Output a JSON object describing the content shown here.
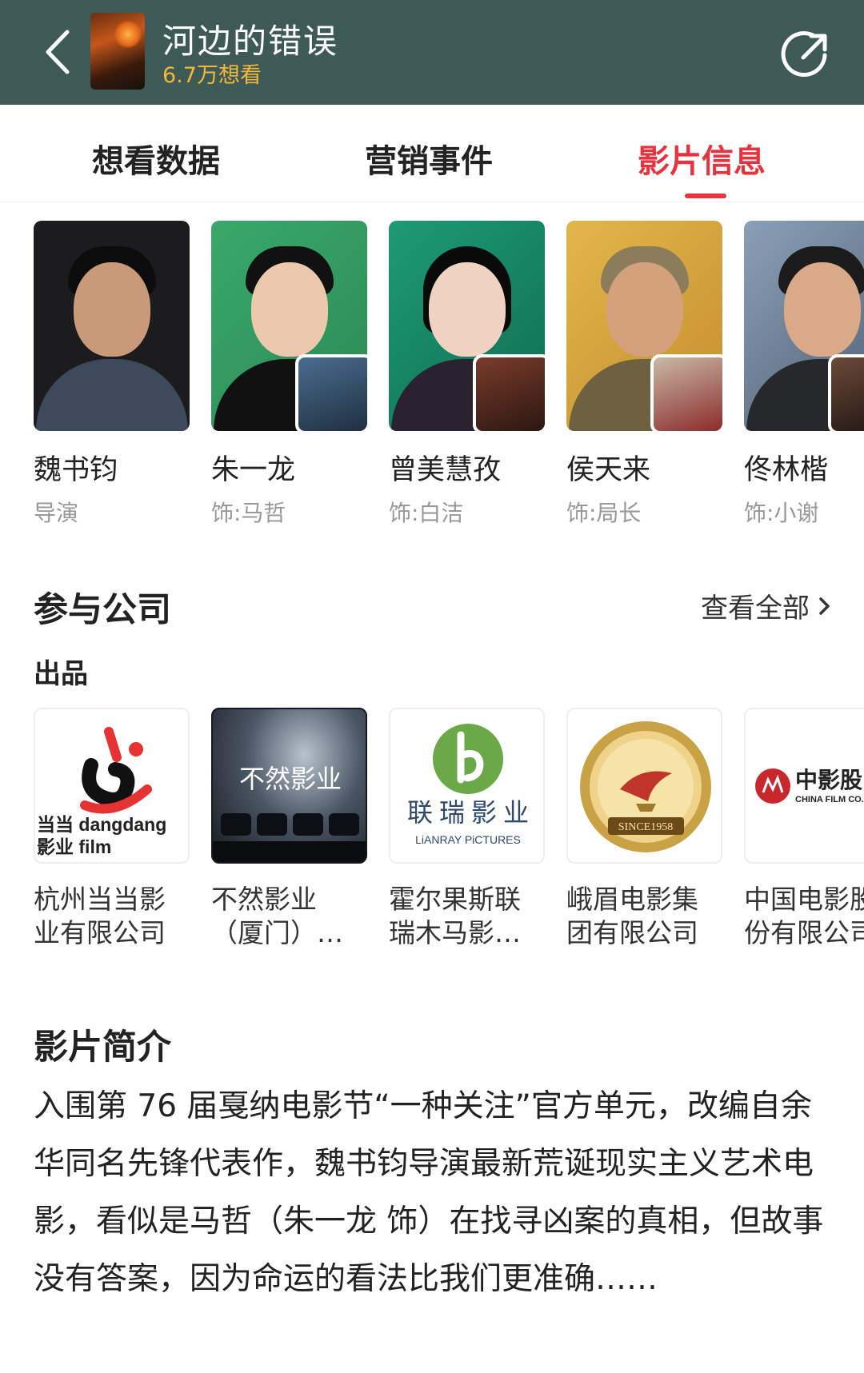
{
  "header": {
    "title": "河边的错误",
    "want_count": "6.7万想看",
    "back_icon": "chevron-left-icon",
    "share_icon": "share-icon"
  },
  "tabs": [
    {
      "label": "想看数据",
      "active": false
    },
    {
      "label": "营销事件",
      "active": false
    },
    {
      "label": "影片信息",
      "active": true
    }
  ],
  "cast": [
    {
      "name": "魏书钧",
      "role": "导演"
    },
    {
      "name": "朱一龙",
      "role": "饰:马哲"
    },
    {
      "name": "曾美慧孜",
      "role": "饰:白洁"
    },
    {
      "name": "侯天来",
      "role": "饰:局长"
    },
    {
      "name": "佟林楷",
      "role": "饰:小谢"
    }
  ],
  "companies_section": {
    "title": "参与公司",
    "view_all": "查看全部",
    "subsection": "出品",
    "companies": [
      {
        "name": "杭州当当影业有限公司",
        "logo_text_1": "当当 dangdang",
        "logo_text_2": "影业 film"
      },
      {
        "name": "不然影业（厦门）…",
        "logo_text_1": "不然影业"
      },
      {
        "name": "霍尔果斯联瑞木马影…",
        "logo_text_1": "联 瑞 影 业",
        "logo_text_2": "LiANRAY PiCTURES"
      },
      {
        "name": "峨眉电影集团有限公司",
        "logo_text_1": "SINCE1958"
      },
      {
        "name": "中国电影股份有限公司",
        "logo_text_1": "中影股",
        "logo_text_2": "CHINA FILM CO."
      }
    ]
  },
  "intro": {
    "title": "影片简介",
    "text": "入围第 76 届戛纳电影节“一种关注”官方单元，改编自余华同名先锋代表作，魏书钧导演最新荒诞现实主义艺术电影，看似是马哲（朱一龙 饰）在找寻凶案的真相，但故事没有答案，因为命运的看法比我们更准确……"
  },
  "colors": {
    "header_bg": "#3e5a56",
    "accent_red": "#e8333f",
    "want_count": "#f5b73a"
  }
}
